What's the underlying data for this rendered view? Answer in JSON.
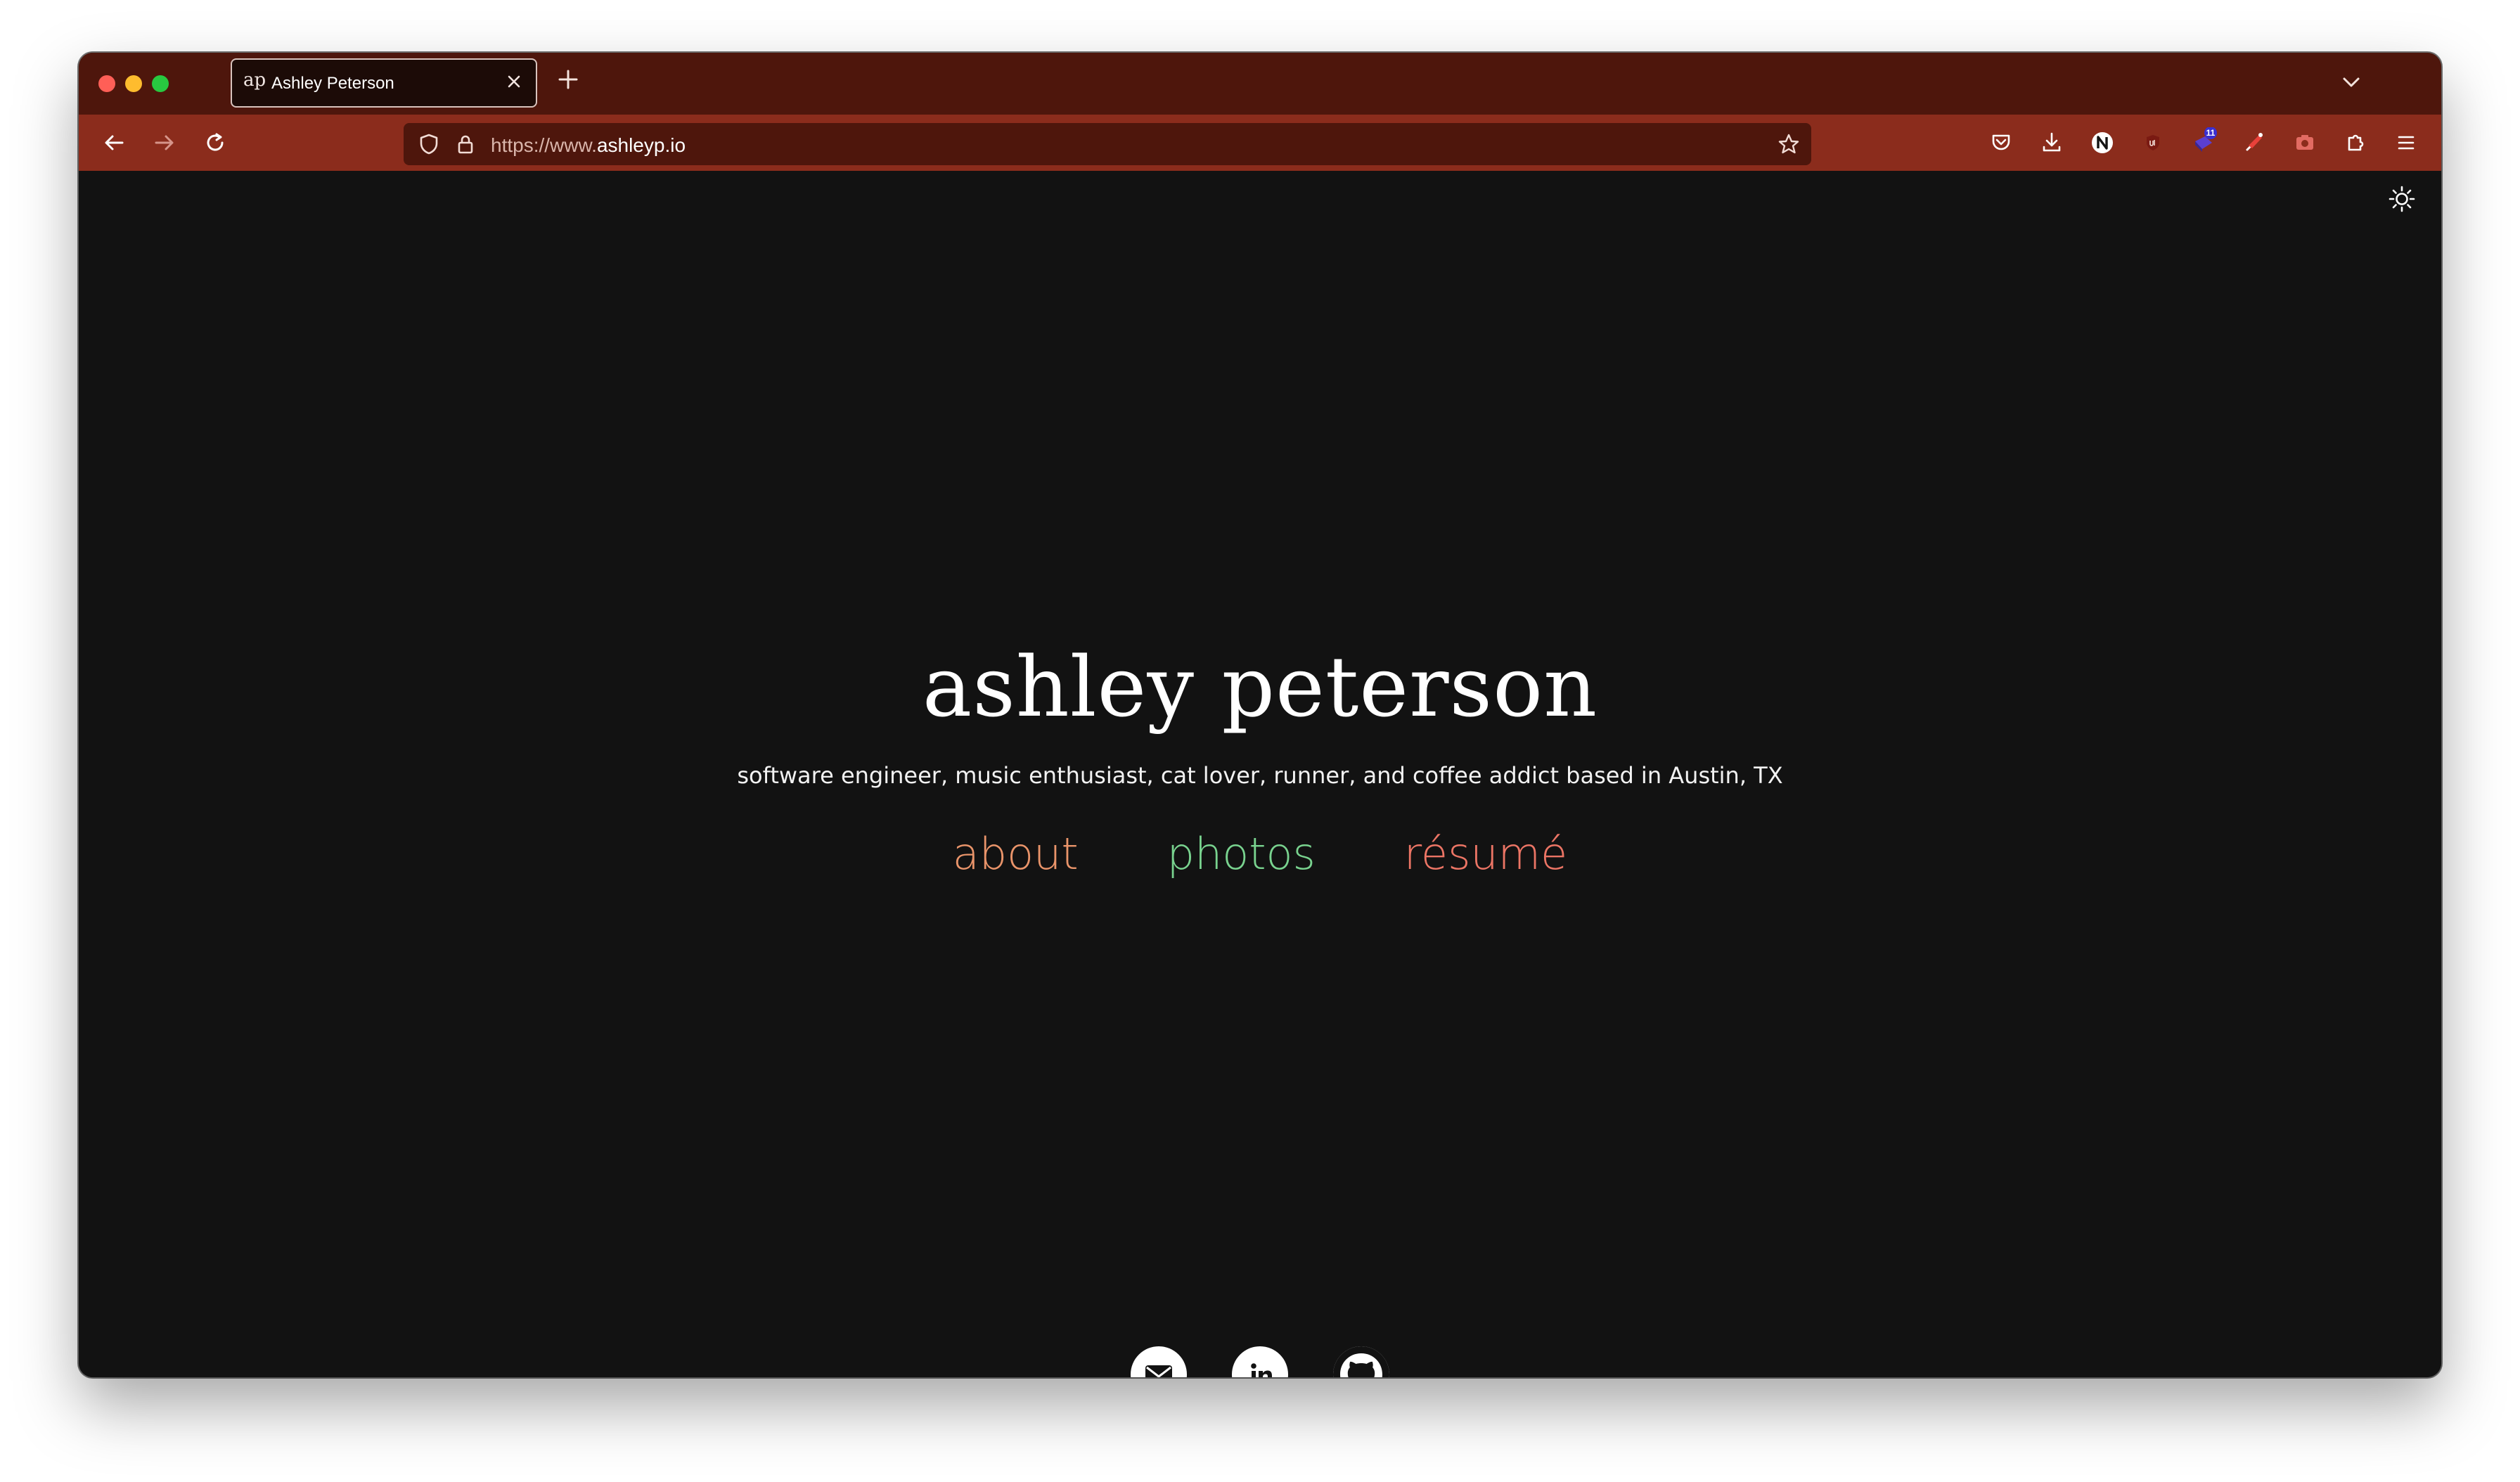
{
  "browser": {
    "tab": {
      "favicon_text": "ap",
      "title": "Ashley Peterson"
    },
    "new_tab_label": "+",
    "url": {
      "prefix": "https://www.",
      "host": "ashleyp.io"
    },
    "extension_badge": "11"
  },
  "page": {
    "title": "ashley peterson",
    "tagline": "software engineer, music enthusiast, cat lover, runner, and coffee addict based in Austin, TX",
    "nav": [
      {
        "label": "about",
        "color": "#e9946a"
      },
      {
        "label": "photos",
        "color": "#79d38f"
      },
      {
        "label": "résumé",
        "color": "#ec7565"
      }
    ],
    "social": [
      "mail-icon",
      "linkedin-icon",
      "github-icon"
    ]
  },
  "colors": {
    "tabstrip": "#4e160c",
    "toolbar": "#8b2c1c",
    "background": "#121212"
  }
}
